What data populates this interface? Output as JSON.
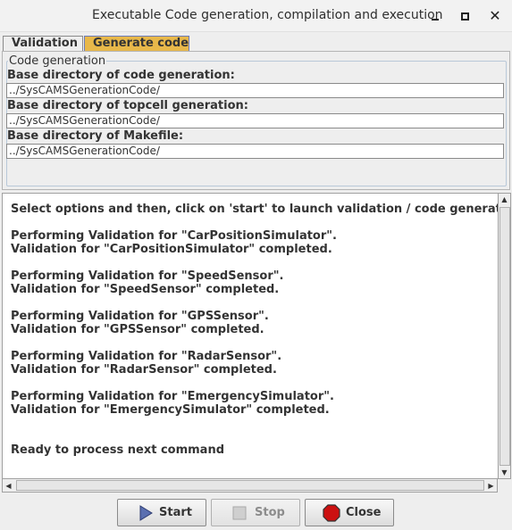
{
  "window": {
    "title": "Executable Code generation, compilation and execution"
  },
  "tabs": [
    {
      "label": "Validation"
    },
    {
      "label": "Generate code"
    }
  ],
  "code_generation": {
    "legend": "Code generation",
    "fields": [
      {
        "label": "Base directory of code generation:",
        "value": "../SysCAMSGenerationCode/"
      },
      {
        "label": "Base directory of topcell generation:",
        "value": "../SysCAMSGenerationCode/"
      },
      {
        "label": "Base directory of Makefile:",
        "value": "../SysCAMSGenerationCode/"
      }
    ]
  },
  "log": {
    "lines": [
      "Select options and then, click on 'start' to launch validation / code generation",
      "Performing Validation for \"CarPositionSimulator\".",
      "Validation for \"CarPositionSimulator\" completed.",
      "Performing Validation for \"SpeedSensor\".",
      "Validation for \"SpeedSensor\" completed.",
      "Performing Validation for \"GPSSensor\".",
      "Validation for \"GPSSensor\" completed.",
      "Performing Validation for \"RadarSensor\".",
      "Validation for \"RadarSensor\" completed.",
      "Performing Validation for \"EmergencySimulator\".",
      "Validation for \"EmergencySimulator\" completed.",
      "Ready to process next command"
    ]
  },
  "buttons": {
    "start": "Start",
    "stop": "Stop",
    "close": "Close"
  },
  "colors": {
    "active_tab": "#e8b84a",
    "start_icon": "#5a6fb0",
    "close_icon": "#cc1111"
  }
}
